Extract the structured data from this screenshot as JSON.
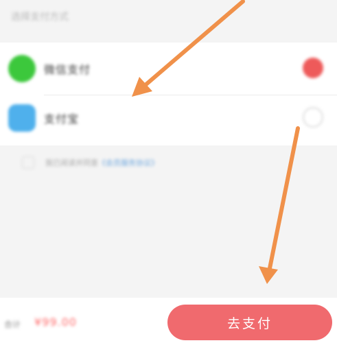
{
  "section": {
    "title": "选择支付方式"
  },
  "payment_methods": [
    {
      "label": "微信支付",
      "icon": "wechat-pay-icon",
      "selected": true
    },
    {
      "label": "支付宝",
      "icon": "alipay-icon",
      "selected": false
    }
  ],
  "agreement": {
    "text": "我已阅读并同意",
    "link_text": "《会员服务协议》"
  },
  "bottom_bar": {
    "total_label": "合计",
    "total_amount": "¥99.00",
    "pay_button_label": "去支付"
  },
  "colors": {
    "accent": "#f06a6e",
    "wechat": "#3cc83c",
    "alipay": "#4fb0ec",
    "annotation_arrow": "#f0914a"
  }
}
